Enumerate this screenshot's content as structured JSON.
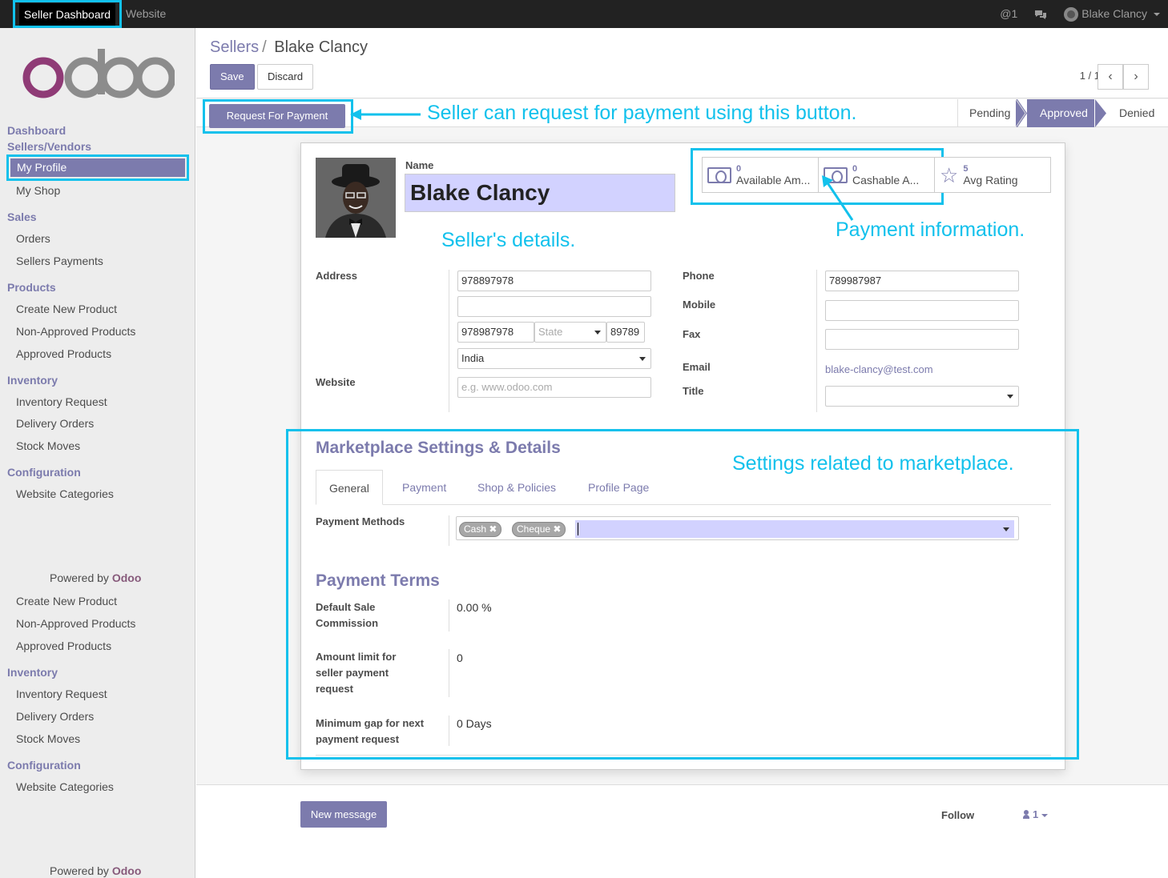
{
  "topbar": {
    "seller_dashboard": "Seller Dashboard",
    "website": "Website",
    "mentions": "@1",
    "user_name": "Blake Clancy"
  },
  "sidebar": {
    "groups1": [
      {
        "section": "Dashboard",
        "items": []
      },
      {
        "section": "Sellers/Vendors",
        "items": [
          "My Profile",
          "My Shop"
        ]
      },
      {
        "section": "Sales",
        "items": [
          "Orders",
          "Sellers Payments"
        ]
      },
      {
        "section": "Products",
        "items": [
          "Create New Product",
          "Non-Approved Products",
          "Approved Products"
        ]
      },
      {
        "section": "Inventory",
        "items": [
          "Inventory Request",
          "Delivery Orders",
          "Stock Moves"
        ]
      },
      {
        "section": "Configuration",
        "items": [
          "Website Categories"
        ]
      }
    ],
    "powered_prefix": "Powered by",
    "powered_brand": "Odoo",
    "groups2_products": [
      "Create New Product",
      "Non-Approved Products",
      "Approved Products"
    ],
    "inventory_label": "Inventory",
    "groups2_inventory": [
      "Inventory Request",
      "Delivery Orders",
      "Stock Moves"
    ],
    "configuration_label": "Configuration",
    "groups2_config": [
      "Website Categories"
    ]
  },
  "control_panel": {
    "breadcrumb_parent": "Sellers",
    "breadcrumb_sep": "/",
    "breadcrumb_current": "Blake Clancy",
    "save": "Save",
    "discard": "Discard",
    "pager": "1 / 1"
  },
  "statusbar": {
    "request_payment": "Request For Payment",
    "stages": [
      "Pending",
      "Approved",
      "Denied"
    ],
    "active_stage": "Approved"
  },
  "form": {
    "name_label": "Name",
    "name_value": "Blake Clancy",
    "stats": [
      {
        "value": "0",
        "label": "Available Am..."
      },
      {
        "value": "0",
        "label": "Cashable A..."
      },
      {
        "value": "5",
        "label": "Avg Rating"
      }
    ],
    "address_label": "Address",
    "street": "978897978",
    "street2": "",
    "city": "978987978",
    "state_placeholder": "State",
    "zip": "89789",
    "country": "India",
    "website_label": "Website",
    "website_placeholder": "e.g. www.odoo.com",
    "phone_label": "Phone",
    "phone_value": "789987987",
    "mobile_label": "Mobile",
    "fax_label": "Fax",
    "email_label": "Email",
    "email_value": "blake-clancy@test.com",
    "title_label": "Title",
    "marketplace_title": "Marketplace Settings & Details",
    "tabs": [
      "General",
      "Payment",
      "Shop & Policies",
      "Profile Page"
    ],
    "payment_methods_label": "Payment Methods",
    "payment_methods": [
      "Cash",
      "Cheque"
    ],
    "payment_terms_title": "Payment Terms",
    "default_commission_label": "Default Sale Commission",
    "default_commission_value": "0.00 %",
    "amount_limit_label": "Amount limit for seller payment request",
    "amount_limit_value": "0",
    "min_gap_label": "Minimum gap for next payment request",
    "min_gap_value": "0 Days"
  },
  "annotations": {
    "request_btn": "Seller can request for payment using this button.",
    "sellers_details": "Seller's details.",
    "payment_info": "Payment information.",
    "marketplace": "Settings related to marketplace."
  },
  "chatter": {
    "new_message": "New message",
    "follow": "Follow",
    "followers": "1"
  },
  "colors": {
    "accent": "#7c7bad",
    "highlight": "#12c1ec",
    "topbar": "#222222"
  }
}
